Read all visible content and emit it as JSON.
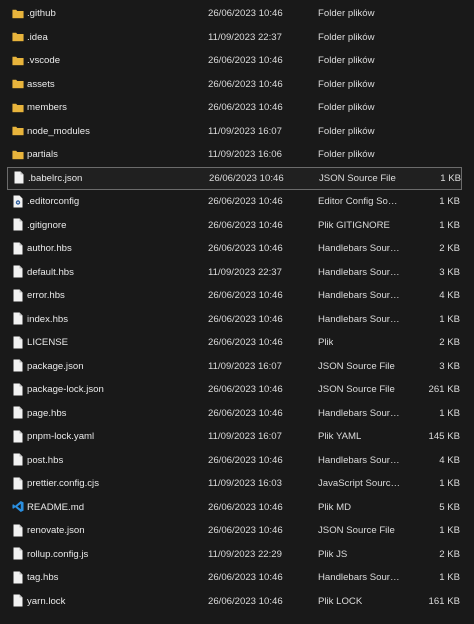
{
  "files": [
    {
      "name": ".github",
      "date": "26/06/2023 10:46",
      "type": "Folder plików",
      "size": "",
      "icon": "folder-icon"
    },
    {
      "name": ".idea",
      "date": "11/09/2023 22:37",
      "type": "Folder plików",
      "size": "",
      "icon": "folder-icon"
    },
    {
      "name": ".vscode",
      "date": "26/06/2023 10:46",
      "type": "Folder plików",
      "size": "",
      "icon": "folder-icon"
    },
    {
      "name": "assets",
      "date": "26/06/2023 10:46",
      "type": "Folder plików",
      "size": "",
      "icon": "folder-icon"
    },
    {
      "name": "members",
      "date": "26/06/2023 10:46",
      "type": "Folder plików",
      "size": "",
      "icon": "folder-icon"
    },
    {
      "name": "node_modules",
      "date": "11/09/2023 16:07",
      "type": "Folder plików",
      "size": "",
      "icon": "folder-icon"
    },
    {
      "name": "partials",
      "date": "11/09/2023 16:06",
      "type": "Folder plików",
      "size": "",
      "icon": "folder-icon"
    },
    {
      "name": ".babelrc.json",
      "date": "26/06/2023 10:46",
      "type": "JSON Source File",
      "size": "1 KB",
      "icon": "file-icon",
      "selected": true
    },
    {
      "name": ".editorconfig",
      "date": "26/06/2023 10:46",
      "type": "Editor Config Sour...",
      "size": "1 KB",
      "icon": "settings-file-icon"
    },
    {
      "name": ".gitignore",
      "date": "26/06/2023 10:46",
      "type": "Plik GITIGNORE",
      "size": "1 KB",
      "icon": "file-icon"
    },
    {
      "name": "author.hbs",
      "date": "26/06/2023 10:46",
      "type": "Handlebars Sourc...",
      "size": "2 KB",
      "icon": "file-icon"
    },
    {
      "name": "default.hbs",
      "date": "11/09/2023 22:37",
      "type": "Handlebars Sourc...",
      "size": "3 KB",
      "icon": "file-icon"
    },
    {
      "name": "error.hbs",
      "date": "26/06/2023 10:46",
      "type": "Handlebars Sourc...",
      "size": "4 KB",
      "icon": "file-icon"
    },
    {
      "name": "index.hbs",
      "date": "26/06/2023 10:46",
      "type": "Handlebars Sourc...",
      "size": "1 KB",
      "icon": "file-icon"
    },
    {
      "name": "LICENSE",
      "date": "26/06/2023 10:46",
      "type": "Plik",
      "size": "2 KB",
      "icon": "file-icon"
    },
    {
      "name": "package.json",
      "date": "11/09/2023 16:07",
      "type": "JSON Source File",
      "size": "3 KB",
      "icon": "file-icon"
    },
    {
      "name": "package-lock.json",
      "date": "26/06/2023 10:46",
      "type": "JSON Source File",
      "size": "261 KB",
      "icon": "file-icon"
    },
    {
      "name": "page.hbs",
      "date": "26/06/2023 10:46",
      "type": "Handlebars Sourc...",
      "size": "1 KB",
      "icon": "file-icon"
    },
    {
      "name": "pnpm-lock.yaml",
      "date": "11/09/2023 16:07",
      "type": "Plik YAML",
      "size": "145 KB",
      "icon": "file-icon"
    },
    {
      "name": "post.hbs",
      "date": "26/06/2023 10:46",
      "type": "Handlebars Sourc...",
      "size": "4 KB",
      "icon": "file-icon"
    },
    {
      "name": "prettier.config.cjs",
      "date": "11/09/2023 16:03",
      "type": "JavaScript Source ...",
      "size": "1 KB",
      "icon": "file-icon"
    },
    {
      "name": "README.md",
      "date": "26/06/2023 10:46",
      "type": "Plik MD",
      "size": "5 KB",
      "icon": "vscode-icon"
    },
    {
      "name": "renovate.json",
      "date": "26/06/2023 10:46",
      "type": "JSON Source File",
      "size": "1 KB",
      "icon": "file-icon"
    },
    {
      "name": "rollup.config.js",
      "date": "11/09/2023 22:29",
      "type": "Plik JS",
      "size": "2 KB",
      "icon": "file-icon"
    },
    {
      "name": "tag.hbs",
      "date": "26/06/2023 10:46",
      "type": "Handlebars Sourc...",
      "size": "1 KB",
      "icon": "file-icon"
    },
    {
      "name": "yarn.lock",
      "date": "26/06/2023 10:46",
      "type": "Plik LOCK",
      "size": "161 KB",
      "icon": "file-icon"
    }
  ],
  "colors": {
    "background": "#191919",
    "folder": "#e8b43c",
    "file": "#f2f2f2",
    "vscode": "#2b8fe0",
    "selected_border": "#6b6b6b"
  }
}
